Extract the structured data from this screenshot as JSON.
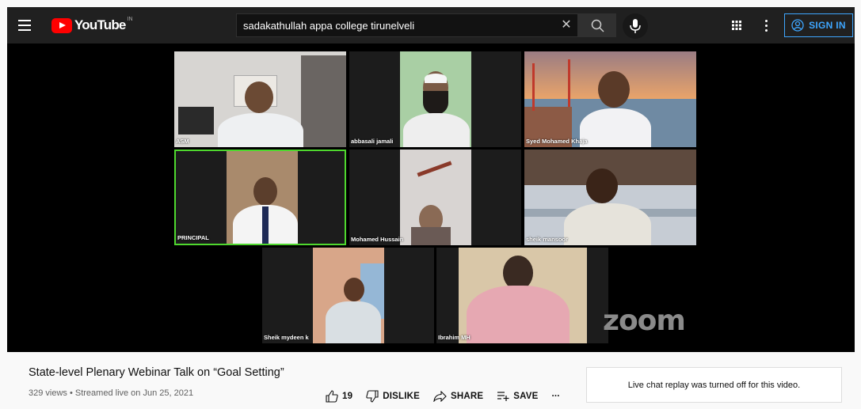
{
  "header": {
    "logo_text": "YouTube",
    "country_code": "IN",
    "search_value": "sadakathullah appa college tirunelveli",
    "signin_label": "SIGN IN"
  },
  "player": {
    "watermark": "zoom",
    "participants": [
      {
        "name": "ASM"
      },
      {
        "name": "abbasali jamali"
      },
      {
        "name": "Syed Mohamed Khaja"
      },
      {
        "name": "PRINCIPAL"
      },
      {
        "name": "Mohamed Hussain"
      },
      {
        "name": "sheik mansoor"
      },
      {
        "name": "Sheik mydeen k"
      },
      {
        "name": "Ibrahim MH"
      }
    ]
  },
  "video": {
    "title": "State-level Plenary Webinar Talk on “Goal Setting”",
    "meta": "329 views • Streamed live on Jun 25, 2021",
    "likes": "19",
    "dislike_label": "DISLIKE",
    "share_label": "SHARE",
    "save_label": "SAVE",
    "more_label": "..."
  },
  "chat": {
    "message": "Live chat replay was turned off for this video."
  },
  "colors": {
    "header_bg": "#202020",
    "brand_red": "#ff0000",
    "signin_blue": "#3ea6ff",
    "active_speaker": "#4fd82e"
  }
}
